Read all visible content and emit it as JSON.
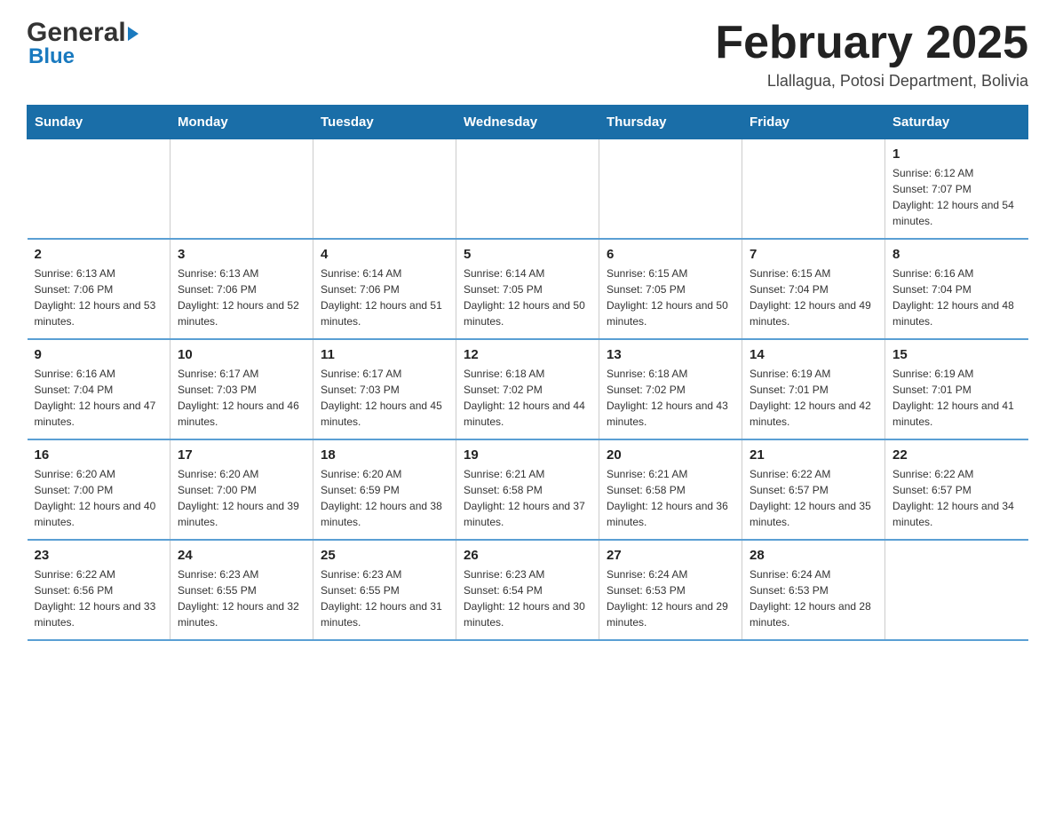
{
  "header": {
    "logo_general": "General",
    "logo_blue": "Blue",
    "title": "February 2025",
    "subtitle": "Llallagua, Potosi Department, Bolivia"
  },
  "days_of_week": [
    "Sunday",
    "Monday",
    "Tuesday",
    "Wednesday",
    "Thursday",
    "Friday",
    "Saturday"
  ],
  "weeks": [
    [
      {
        "date": "",
        "info": ""
      },
      {
        "date": "",
        "info": ""
      },
      {
        "date": "",
        "info": ""
      },
      {
        "date": "",
        "info": ""
      },
      {
        "date": "",
        "info": ""
      },
      {
        "date": "",
        "info": ""
      },
      {
        "date": "1",
        "info": "Sunrise: 6:12 AM\nSunset: 7:07 PM\nDaylight: 12 hours and 54 minutes."
      }
    ],
    [
      {
        "date": "2",
        "info": "Sunrise: 6:13 AM\nSunset: 7:06 PM\nDaylight: 12 hours and 53 minutes."
      },
      {
        "date": "3",
        "info": "Sunrise: 6:13 AM\nSunset: 7:06 PM\nDaylight: 12 hours and 52 minutes."
      },
      {
        "date": "4",
        "info": "Sunrise: 6:14 AM\nSunset: 7:06 PM\nDaylight: 12 hours and 51 minutes."
      },
      {
        "date": "5",
        "info": "Sunrise: 6:14 AM\nSunset: 7:05 PM\nDaylight: 12 hours and 50 minutes."
      },
      {
        "date": "6",
        "info": "Sunrise: 6:15 AM\nSunset: 7:05 PM\nDaylight: 12 hours and 50 minutes."
      },
      {
        "date": "7",
        "info": "Sunrise: 6:15 AM\nSunset: 7:04 PM\nDaylight: 12 hours and 49 minutes."
      },
      {
        "date": "8",
        "info": "Sunrise: 6:16 AM\nSunset: 7:04 PM\nDaylight: 12 hours and 48 minutes."
      }
    ],
    [
      {
        "date": "9",
        "info": "Sunrise: 6:16 AM\nSunset: 7:04 PM\nDaylight: 12 hours and 47 minutes."
      },
      {
        "date": "10",
        "info": "Sunrise: 6:17 AM\nSunset: 7:03 PM\nDaylight: 12 hours and 46 minutes."
      },
      {
        "date": "11",
        "info": "Sunrise: 6:17 AM\nSunset: 7:03 PM\nDaylight: 12 hours and 45 minutes."
      },
      {
        "date": "12",
        "info": "Sunrise: 6:18 AM\nSunset: 7:02 PM\nDaylight: 12 hours and 44 minutes."
      },
      {
        "date": "13",
        "info": "Sunrise: 6:18 AM\nSunset: 7:02 PM\nDaylight: 12 hours and 43 minutes."
      },
      {
        "date": "14",
        "info": "Sunrise: 6:19 AM\nSunset: 7:01 PM\nDaylight: 12 hours and 42 minutes."
      },
      {
        "date": "15",
        "info": "Sunrise: 6:19 AM\nSunset: 7:01 PM\nDaylight: 12 hours and 41 minutes."
      }
    ],
    [
      {
        "date": "16",
        "info": "Sunrise: 6:20 AM\nSunset: 7:00 PM\nDaylight: 12 hours and 40 minutes."
      },
      {
        "date": "17",
        "info": "Sunrise: 6:20 AM\nSunset: 7:00 PM\nDaylight: 12 hours and 39 minutes."
      },
      {
        "date": "18",
        "info": "Sunrise: 6:20 AM\nSunset: 6:59 PM\nDaylight: 12 hours and 38 minutes."
      },
      {
        "date": "19",
        "info": "Sunrise: 6:21 AM\nSunset: 6:58 PM\nDaylight: 12 hours and 37 minutes."
      },
      {
        "date": "20",
        "info": "Sunrise: 6:21 AM\nSunset: 6:58 PM\nDaylight: 12 hours and 36 minutes."
      },
      {
        "date": "21",
        "info": "Sunrise: 6:22 AM\nSunset: 6:57 PM\nDaylight: 12 hours and 35 minutes."
      },
      {
        "date": "22",
        "info": "Sunrise: 6:22 AM\nSunset: 6:57 PM\nDaylight: 12 hours and 34 minutes."
      }
    ],
    [
      {
        "date": "23",
        "info": "Sunrise: 6:22 AM\nSunset: 6:56 PM\nDaylight: 12 hours and 33 minutes."
      },
      {
        "date": "24",
        "info": "Sunrise: 6:23 AM\nSunset: 6:55 PM\nDaylight: 12 hours and 32 minutes."
      },
      {
        "date": "25",
        "info": "Sunrise: 6:23 AM\nSunset: 6:55 PM\nDaylight: 12 hours and 31 minutes."
      },
      {
        "date": "26",
        "info": "Sunrise: 6:23 AM\nSunset: 6:54 PM\nDaylight: 12 hours and 30 minutes."
      },
      {
        "date": "27",
        "info": "Sunrise: 6:24 AM\nSunset: 6:53 PM\nDaylight: 12 hours and 29 minutes."
      },
      {
        "date": "28",
        "info": "Sunrise: 6:24 AM\nSunset: 6:53 PM\nDaylight: 12 hours and 28 minutes."
      },
      {
        "date": "",
        "info": ""
      }
    ]
  ]
}
